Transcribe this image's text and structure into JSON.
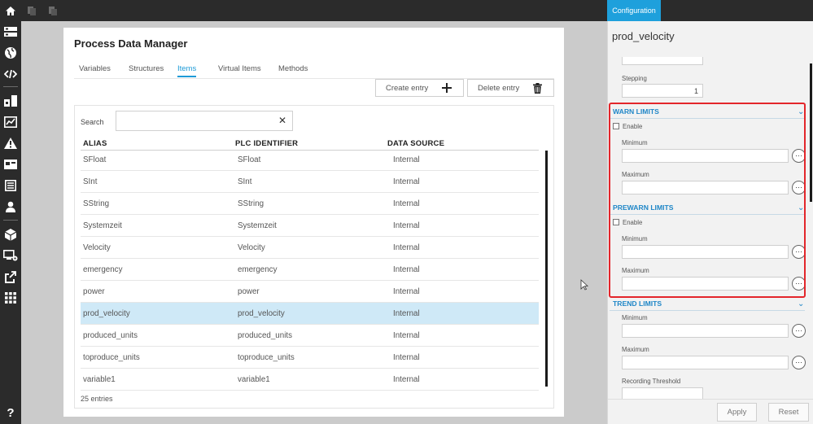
{
  "topbar": {
    "icons": [
      "home-icon",
      "copy-icon",
      "paste-icon"
    ],
    "config_tab": "Configuration"
  },
  "sidebar": {
    "icons": [
      "list-icon",
      "globe-icon",
      "code-icon",
      "blocks-icon",
      "chart-icon",
      "warning-icon",
      "card-icon",
      "document-icon",
      "user-icon",
      "cube-icon",
      "network-settings-icon",
      "export-icon",
      "grid-icon"
    ],
    "help": "?"
  },
  "main": {
    "title": "Process Data Manager",
    "tabs": [
      "Variables",
      "Structures",
      "Items",
      "Virtual Items",
      "Methods"
    ],
    "active_tab": "Items",
    "create_label": "Create entry",
    "delete_label": "Delete entry",
    "search_label": "Search",
    "search_value": "",
    "columns": [
      "ALIAS",
      "PLC IDENTIFIER",
      "DATA SOURCE"
    ],
    "rows": [
      {
        "alias": "SFloat",
        "plc": "SFloat",
        "source": "Internal"
      },
      {
        "alias": "SInt",
        "plc": "SInt",
        "source": "Internal"
      },
      {
        "alias": "SString",
        "plc": "SString",
        "source": "Internal"
      },
      {
        "alias": "Systemzeit",
        "plc": "Systemzeit",
        "source": "Internal"
      },
      {
        "alias": "Velocity",
        "plc": "Velocity",
        "source": "Internal"
      },
      {
        "alias": "emergency",
        "plc": "emergency",
        "source": "Internal"
      },
      {
        "alias": "power",
        "plc": "power",
        "source": "Internal"
      },
      {
        "alias": "prod_velocity",
        "plc": "prod_velocity",
        "source": "Internal",
        "selected": true
      },
      {
        "alias": "produced_units",
        "plc": "produced_units",
        "source": "Internal"
      },
      {
        "alias": "toproduce_units",
        "plc": "toproduce_units",
        "source": "Internal"
      },
      {
        "alias": "variable1",
        "plc": "variable1",
        "source": "Internal"
      }
    ],
    "entries": "25 entries"
  },
  "config": {
    "title": "prod_velocity",
    "stepping_label": "Stepping",
    "stepping_value": "1",
    "warn": {
      "title": "WARN LIMITS",
      "enable": "Enable",
      "min": "Minimum",
      "max": "Maximum"
    },
    "prewarn": {
      "title": "PREWARN LIMITS",
      "enable": "Enable",
      "min": "Minimum",
      "max": "Maximum"
    },
    "trend": {
      "title": "TREND LIMITS",
      "min": "Minimum",
      "max": "Maximum",
      "threshold": "Recording Threshold"
    },
    "more": "···",
    "apply": "Apply",
    "reset": "Reset"
  }
}
